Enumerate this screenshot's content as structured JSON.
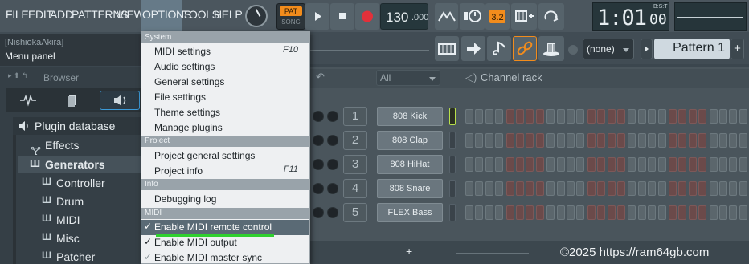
{
  "menu": {
    "items": [
      "FILE",
      "EDIT",
      "ADD",
      "PATTERNS",
      "VIEW",
      "OPTIONS",
      "TOOLS",
      "HELP"
    ]
  },
  "transport": {
    "pat_label": "PAT",
    "song_label": "SONG",
    "tempo": "130",
    "tempo_decimal": ".000",
    "time": "1:01",
    "time_sub": "00",
    "time_mode": "B:S:T"
  },
  "hint": {
    "user": "[NishiokaAkira]",
    "panel": "Menu panel"
  },
  "toolbar": {
    "pattern_none": "(none)",
    "pattern_name": "Pattern 1",
    "plus": "+"
  },
  "browser": {
    "title": "Browser"
  },
  "plugin_db": {
    "title": "Plugin database",
    "items": [
      "Effects",
      "Generators",
      "Controller",
      "Drum",
      "MIDI",
      "Misc",
      "Patcher"
    ]
  },
  "channel_rack": {
    "filter": "All",
    "title": "Channel rack",
    "add": "+",
    "channels": [
      {
        "num": "1",
        "name": "808 Kick"
      },
      {
        "num": "2",
        "name": "808 Clap"
      },
      {
        "num": "3",
        "name": "808 HiHat"
      },
      {
        "num": "4",
        "name": "808 Snare"
      },
      {
        "num": "5",
        "name": "FLEX Bass"
      }
    ]
  },
  "options_menu": {
    "sections": [
      "System",
      "Project",
      "Info",
      "MIDI"
    ],
    "system_items": [
      "MIDI settings",
      "Audio settings",
      "General settings",
      "File settings",
      "Theme settings",
      "Manage plugins"
    ],
    "midi_shortcut": "F10",
    "project_items": [
      "Project general settings",
      "Project info"
    ],
    "project_shortcut": "F11",
    "info_items": [
      "Debugging log"
    ],
    "midi_items": [
      "Enable MIDI remote control",
      "Enable MIDI output",
      "Enable MIDI master sync"
    ],
    "check": "✓"
  },
  "watermark": "©2025 https://ram64gb.com",
  "colors": {
    "accent": "#f28c1c",
    "highlight_bar": "#2fd02f",
    "pad_red": "#6b4a4a",
    "pad_grey": "#5b666c"
  }
}
